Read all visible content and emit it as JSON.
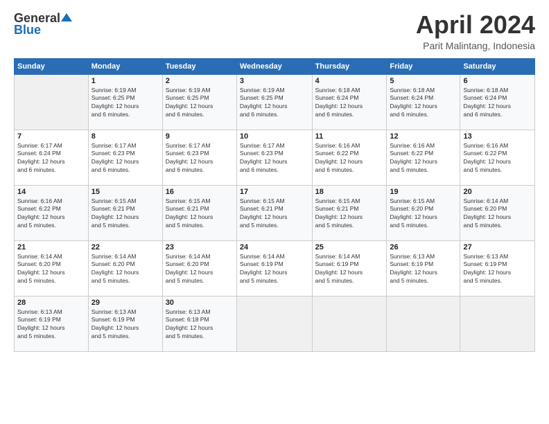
{
  "header": {
    "logo_line1": "General",
    "logo_line2": "Blue",
    "title": "April 2024",
    "subtitle": "Parit Malintang, Indonesia"
  },
  "calendar": {
    "days_of_week": [
      "Sunday",
      "Monday",
      "Tuesday",
      "Wednesday",
      "Thursday",
      "Friday",
      "Saturday"
    ],
    "weeks": [
      [
        {
          "day": "",
          "info": ""
        },
        {
          "day": "1",
          "info": "Sunrise: 6:19 AM\nSunset: 6:25 PM\nDaylight: 12 hours\nand 6 minutes."
        },
        {
          "day": "2",
          "info": "Sunrise: 6:19 AM\nSunset: 6:25 PM\nDaylight: 12 hours\nand 6 minutes."
        },
        {
          "day": "3",
          "info": "Sunrise: 6:19 AM\nSunset: 6:25 PM\nDaylight: 12 hours\nand 6 minutes."
        },
        {
          "day": "4",
          "info": "Sunrise: 6:18 AM\nSunset: 6:24 PM\nDaylight: 12 hours\nand 6 minutes."
        },
        {
          "day": "5",
          "info": "Sunrise: 6:18 AM\nSunset: 6:24 PM\nDaylight: 12 hours\nand 6 minutes."
        },
        {
          "day": "6",
          "info": "Sunrise: 6:18 AM\nSunset: 6:24 PM\nDaylight: 12 hours\nand 6 minutes."
        }
      ],
      [
        {
          "day": "7",
          "info": "Sunrise: 6:17 AM\nSunset: 6:24 PM\nDaylight: 12 hours\nand 6 minutes."
        },
        {
          "day": "8",
          "info": "Sunrise: 6:17 AM\nSunset: 6:23 PM\nDaylight: 12 hours\nand 6 minutes."
        },
        {
          "day": "9",
          "info": "Sunrise: 6:17 AM\nSunset: 6:23 PM\nDaylight: 12 hours\nand 6 minutes."
        },
        {
          "day": "10",
          "info": "Sunrise: 6:17 AM\nSunset: 6:23 PM\nDaylight: 12 hours\nand 6 minutes."
        },
        {
          "day": "11",
          "info": "Sunrise: 6:16 AM\nSunset: 6:22 PM\nDaylight: 12 hours\nand 6 minutes."
        },
        {
          "day": "12",
          "info": "Sunrise: 6:16 AM\nSunset: 6:22 PM\nDaylight: 12 hours\nand 5 minutes."
        },
        {
          "day": "13",
          "info": "Sunrise: 6:16 AM\nSunset: 6:22 PM\nDaylight: 12 hours\nand 5 minutes."
        }
      ],
      [
        {
          "day": "14",
          "info": "Sunrise: 6:16 AM\nSunset: 6:22 PM\nDaylight: 12 hours\nand 5 minutes."
        },
        {
          "day": "15",
          "info": "Sunrise: 6:15 AM\nSunset: 6:21 PM\nDaylight: 12 hours\nand 5 minutes."
        },
        {
          "day": "16",
          "info": "Sunrise: 6:15 AM\nSunset: 6:21 PM\nDaylight: 12 hours\nand 5 minutes."
        },
        {
          "day": "17",
          "info": "Sunrise: 6:15 AM\nSunset: 6:21 PM\nDaylight: 12 hours\nand 5 minutes."
        },
        {
          "day": "18",
          "info": "Sunrise: 6:15 AM\nSunset: 6:21 PM\nDaylight: 12 hours\nand 5 minutes."
        },
        {
          "day": "19",
          "info": "Sunrise: 6:15 AM\nSunset: 6:20 PM\nDaylight: 12 hours\nand 5 minutes."
        },
        {
          "day": "20",
          "info": "Sunrise: 6:14 AM\nSunset: 6:20 PM\nDaylight: 12 hours\nand 5 minutes."
        }
      ],
      [
        {
          "day": "21",
          "info": "Sunrise: 6:14 AM\nSunset: 6:20 PM\nDaylight: 12 hours\nand 5 minutes."
        },
        {
          "day": "22",
          "info": "Sunrise: 6:14 AM\nSunset: 6:20 PM\nDaylight: 12 hours\nand 5 minutes."
        },
        {
          "day": "23",
          "info": "Sunrise: 6:14 AM\nSunset: 6:20 PM\nDaylight: 12 hours\nand 5 minutes."
        },
        {
          "day": "24",
          "info": "Sunrise: 6:14 AM\nSunset: 6:19 PM\nDaylight: 12 hours\nand 5 minutes."
        },
        {
          "day": "25",
          "info": "Sunrise: 6:14 AM\nSunset: 6:19 PM\nDaylight: 12 hours\nand 5 minutes."
        },
        {
          "day": "26",
          "info": "Sunrise: 6:13 AM\nSunset: 6:19 PM\nDaylight: 12 hours\nand 5 minutes."
        },
        {
          "day": "27",
          "info": "Sunrise: 6:13 AM\nSunset: 6:19 PM\nDaylight: 12 hours\nand 5 minutes."
        }
      ],
      [
        {
          "day": "28",
          "info": "Sunrise: 6:13 AM\nSunset: 6:19 PM\nDaylight: 12 hours\nand 5 minutes."
        },
        {
          "day": "29",
          "info": "Sunrise: 6:13 AM\nSunset: 6:19 PM\nDaylight: 12 hours\nand 5 minutes."
        },
        {
          "day": "30",
          "info": "Sunrise: 6:13 AM\nSunset: 6:18 PM\nDaylight: 12 hours\nand 5 minutes."
        },
        {
          "day": "",
          "info": ""
        },
        {
          "day": "",
          "info": ""
        },
        {
          "day": "",
          "info": ""
        },
        {
          "day": "",
          "info": ""
        }
      ]
    ]
  }
}
